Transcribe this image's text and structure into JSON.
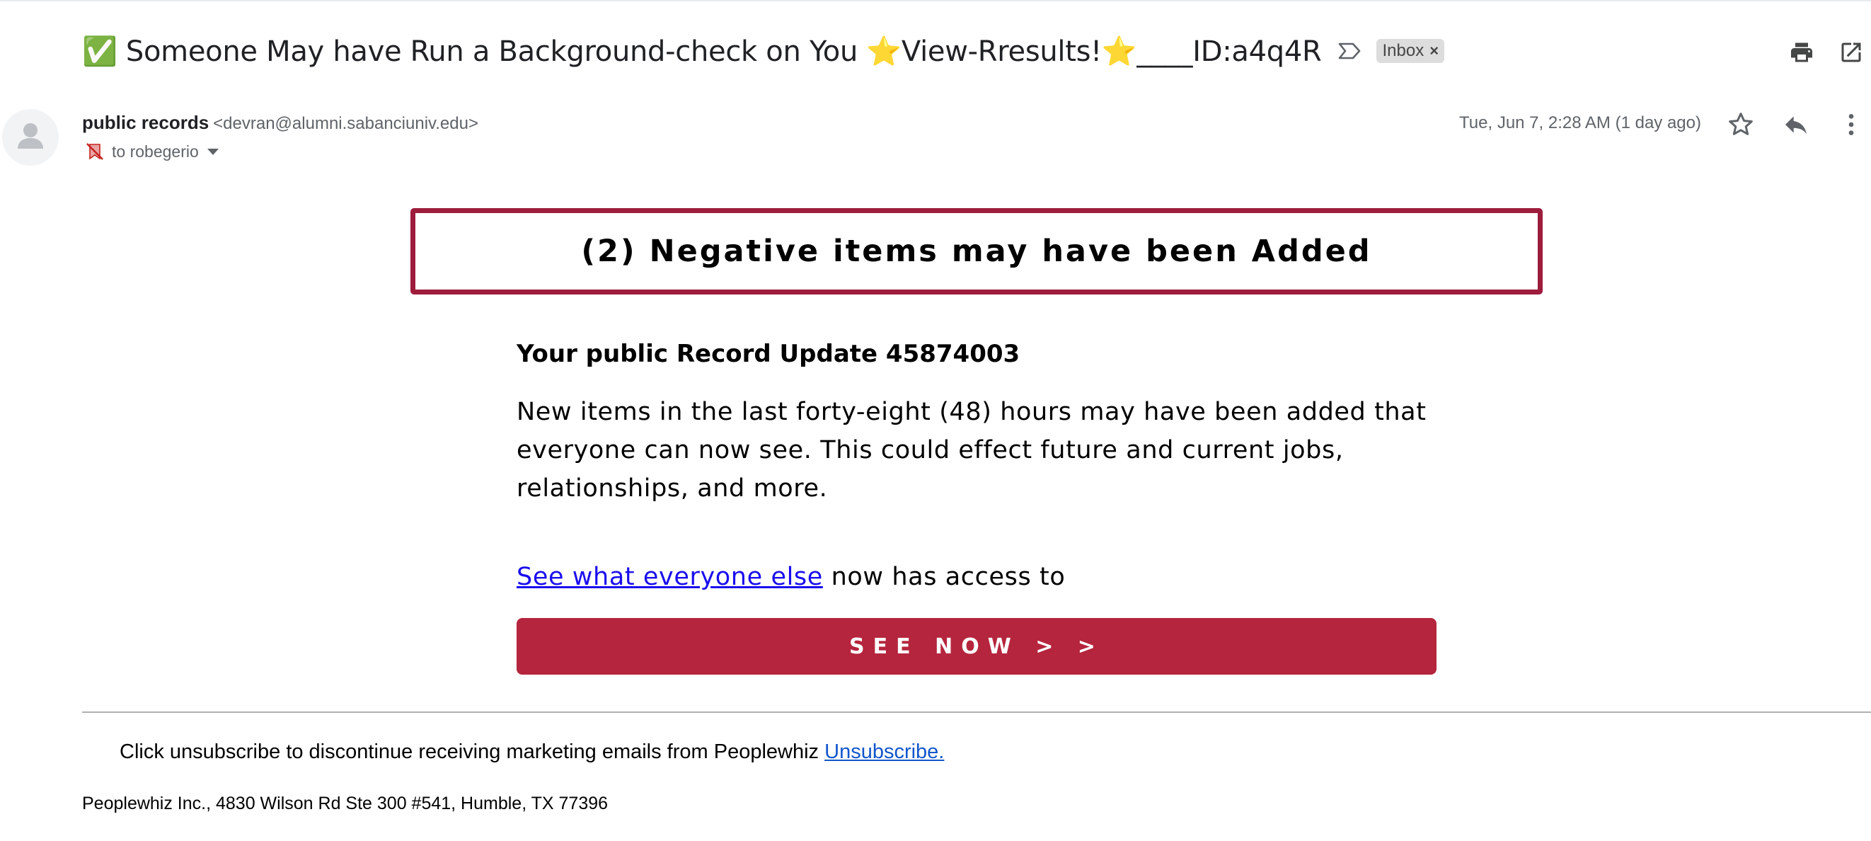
{
  "email": {
    "subject": "✅ Someone May have Run a Background-check on You ⭐View-Rresults!⭐____ID:a4q4R",
    "label": "Inbox",
    "label_remove": "×",
    "sender_name": "public records",
    "sender_email": "<devran@alumni.sabanciuniv.edu>",
    "recipient": "to robegerio",
    "date": "Tue, Jun 7, 2:28 AM (1 day ago)"
  },
  "body": {
    "banner": "(2) Negative items may have been Added",
    "record_title": "Your public Record Update 45874003",
    "record_text": "New items in the last forty-eight (48) hours may have been added that everyone can now see. This could effect future and current jobs, relationships, and more.",
    "link_text": "See what everyone else",
    "link_suffix": " now has access to",
    "button_label": "SEE NOW > >"
  },
  "footer": {
    "unsubscribe_text": "Click unsubscribe to discontinue receiving marketing emails from Peoplewhiz ",
    "unsubscribe_link": "Unsubscribe.",
    "address": "Peoplewhiz Inc., 4830 Wilson Rd Ste 300 #541, Humble, TX 77396"
  },
  "icons": {
    "important_marker": "label-important-outline-icon",
    "print": "print-icon",
    "open_new_window": "open-in-new-window-icon",
    "star": "star-outline-icon",
    "reply": "reply-icon",
    "more": "more-vertical-icon",
    "avatar": "default-avatar-icon",
    "unsubscribed": "unsubscribed-icon"
  },
  "colors": {
    "banner_border": "#9e1c3c",
    "button_bg": "#b5253d",
    "link": "#1a0dee",
    "chip_bg": "#dddddd"
  }
}
